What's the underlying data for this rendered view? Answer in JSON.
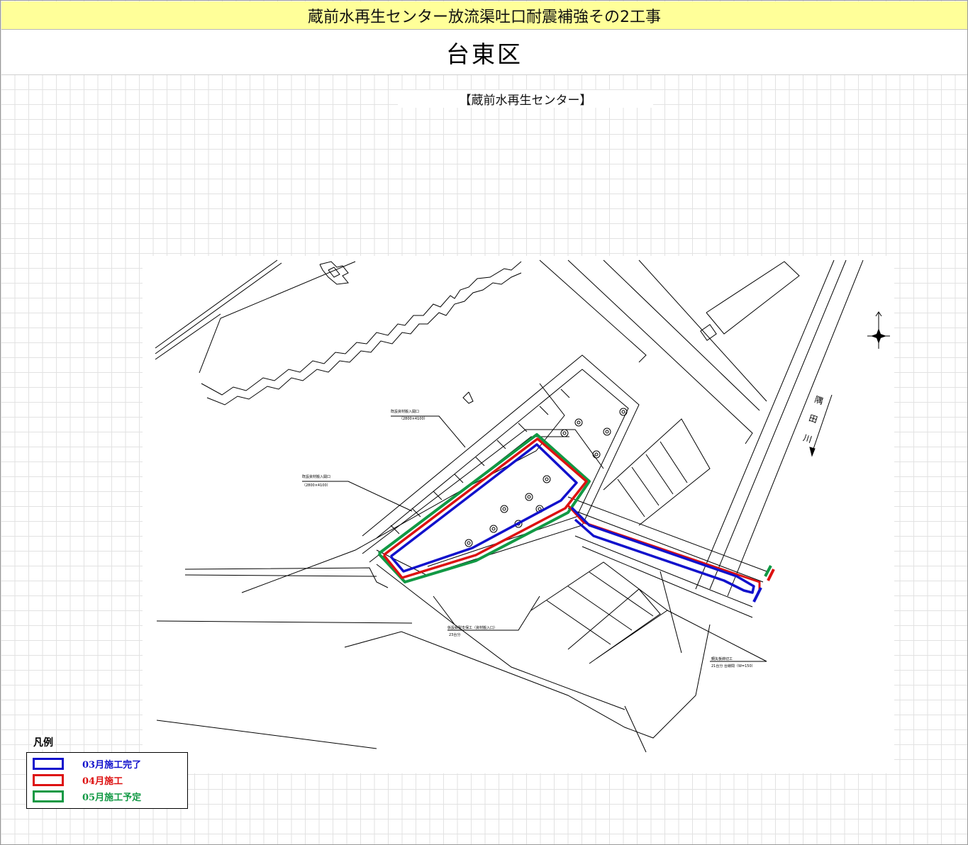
{
  "header": {
    "title": "蔵前水再生センター放流渠吐口耐震補強その2工事",
    "ward": "台東区"
  },
  "drawing": {
    "facility_label": "【蔵前水再生センター】",
    "river_name": [
      "隅",
      "田",
      "川"
    ],
    "annotations": {
      "material_opening_top": "既設資材搬入開口",
      "material_opening_top_size": "（2800×4100）",
      "material_opening_left": "既設資材搬入開口",
      "material_opening_left_size": "（2800×4100）",
      "temp_support_bottom": "仮設鉄製支保工（資材搬入口）",
      "temp_support_bottom_count": "23台分",
      "cofferdam_right": "鋼矢板締切工",
      "cofferdam_right_count": "21台分 台線間（W=150）"
    }
  },
  "legend": {
    "title": "凡例",
    "items": [
      {
        "label": "03月施工完了",
        "color": "#1111cc"
      },
      {
        "label": "04月施工",
        "color": "#dd1111"
      },
      {
        "label": "05月施工予定",
        "color": "#119944"
      }
    ]
  },
  "colors": {
    "title_bar": "#ffff99",
    "completed": "#1111cc",
    "in_progress": "#dd1111",
    "planned": "#119944"
  }
}
